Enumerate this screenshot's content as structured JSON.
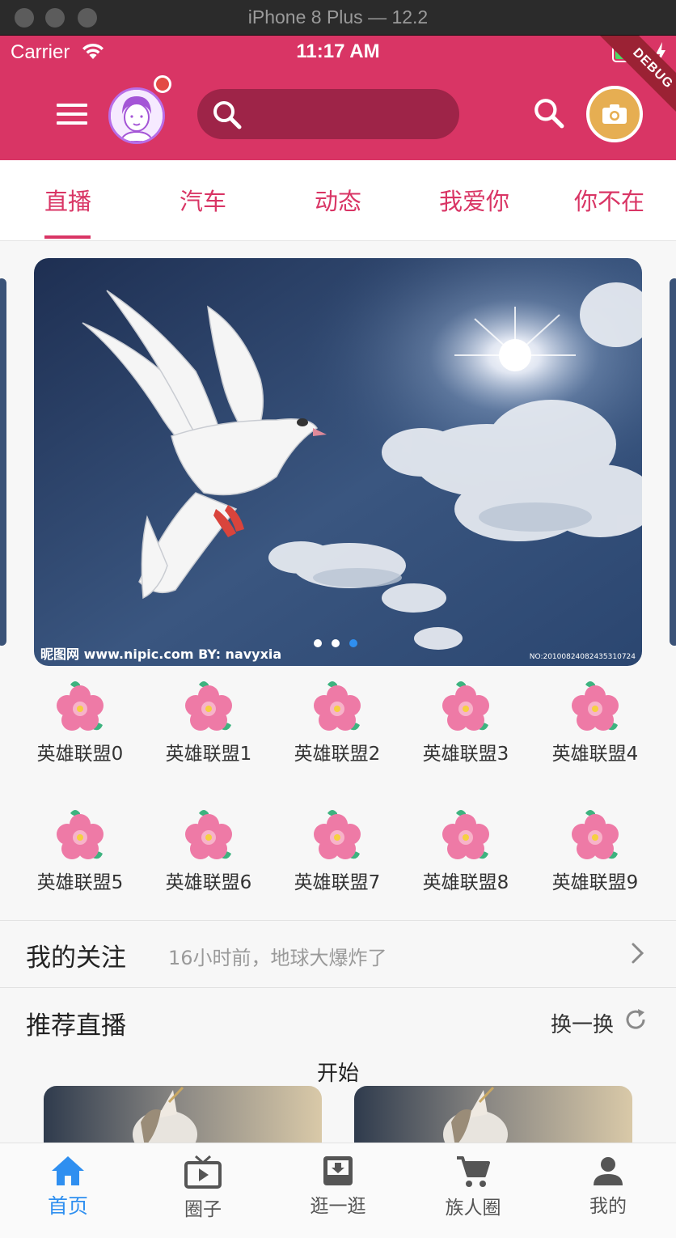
{
  "window": {
    "title": "iPhone 8 Plus — 12.2"
  },
  "status_bar": {
    "carrier": "Carrier",
    "time": "11:17 AM"
  },
  "debug_banner": "DEBUG",
  "search": {
    "placeholder": ""
  },
  "tabs": [
    {
      "label": "直播",
      "active": true
    },
    {
      "label": "汽车"
    },
    {
      "label": "动态"
    },
    {
      "label": "我爱你"
    },
    {
      "label": "你不在"
    }
  ],
  "banner": {
    "watermark_left": "昵图网 www.nipic.com  BY: navyxia",
    "watermark_right": "NO:20100824082435310724",
    "page_count": 3,
    "active_page": 3
  },
  "grid_items": [
    "英雄联盟0",
    "英雄联盟1",
    "英雄联盟2",
    "英雄联盟3",
    "英雄联盟4",
    "英雄联盟5",
    "英雄联盟6",
    "英雄联盟7",
    "英雄联盟8",
    "英雄联盟9"
  ],
  "follow": {
    "heading": "我的关注",
    "latest": "16小时前，地球大爆炸了"
  },
  "recommend": {
    "heading": "推荐直播",
    "refresh_label": "换一换",
    "start_label": "开始"
  },
  "bottom_nav": [
    {
      "label": "首页",
      "icon": "home-icon",
      "active": true
    },
    {
      "label": "圈子",
      "icon": "tv-icon"
    },
    {
      "label": "逛一逛",
      "icon": "inbox-download-icon"
    },
    {
      "label": "族人圈",
      "icon": "cart-icon"
    },
    {
      "label": "我的",
      "icon": "person-icon"
    }
  ],
  "colors": {
    "primary": "#d93565",
    "search_bg": "#9e2448",
    "camera": "#e6ae52",
    "active_nav": "#2f8ff0"
  }
}
